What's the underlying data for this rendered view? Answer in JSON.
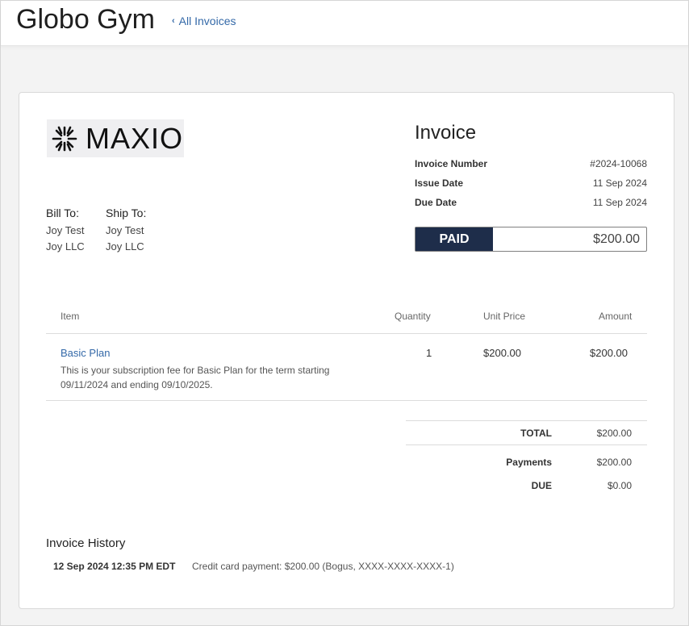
{
  "header": {
    "brand": "Globo Gym",
    "back_label": "All Invoices"
  },
  "logo": {
    "text": "MAXIO",
    "icon": "maxio-logo-mark"
  },
  "bill_to": {
    "heading": "Bill To:",
    "name": "Joy Test",
    "company": "Joy LLC"
  },
  "ship_to": {
    "heading": "Ship To:",
    "name": "Joy Test",
    "company": "Joy LLC"
  },
  "invoice": {
    "title": "Invoice",
    "number_label": "Invoice Number",
    "number": "#2024-10068",
    "issue_label": "Issue Date",
    "issue_date": "11 Sep 2024",
    "due_label": "Due Date",
    "due_date": "11 Sep 2024",
    "status": "PAID",
    "status_amount": "$200.00"
  },
  "table": {
    "headers": {
      "item": "Item",
      "quantity": "Quantity",
      "unit_price": "Unit Price",
      "amount": "Amount"
    },
    "rows": [
      {
        "name": "Basic Plan",
        "description": "This is your subscription fee for Basic Plan for the term starting 09/11/2024 and ending 09/10/2025.",
        "quantity": "1",
        "unit_price": "$200.00",
        "amount": "$200.00"
      }
    ]
  },
  "summary": {
    "total_label": "TOTAL",
    "total": "$200.00",
    "payments_label": "Payments",
    "payments": "$200.00",
    "due_label": "DUE",
    "due": "$0.00"
  },
  "history": {
    "title": "Invoice History",
    "entries": [
      {
        "date": "12 Sep 2024 12:35 PM EDT",
        "description": "Credit card payment: $200.00 (Bogus, XXXX-XXXX-XXXX-1)"
      }
    ]
  },
  "colors": {
    "paid_bg": "#1e2d4a",
    "link": "#3469a8"
  }
}
